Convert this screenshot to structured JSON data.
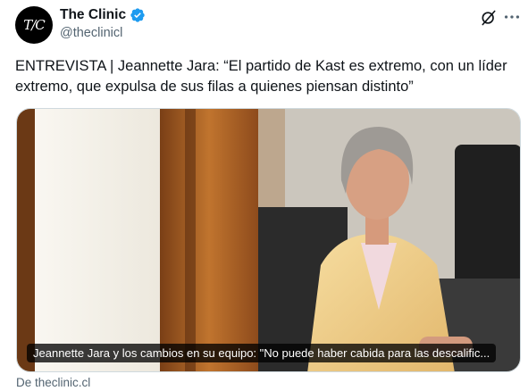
{
  "account": {
    "avatar_text": "T/C",
    "display_name": "The Clinic",
    "handle": "@theclinicl",
    "verified": true,
    "verified_color": "#1d9bf0"
  },
  "actions": {
    "grok_icon": "grok-icon",
    "more_icon": "more-icon"
  },
  "tweet": {
    "text": "ENTREVISTA | Jeannette Jara: “El partido de Kast es extremo, con un líder extremo, que expulsa de sus filas a quienes piensan distinto”"
  },
  "card": {
    "caption": "Jeannette Jara y los cambios en su equipo: \"No puede haber cabida para las descalific...",
    "source": "De theclinic.cl"
  }
}
